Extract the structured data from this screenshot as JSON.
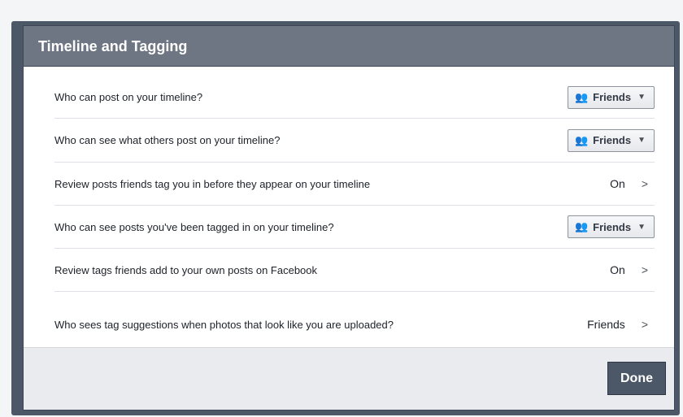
{
  "dialog": {
    "title": "Timeline and Tagging",
    "done_label": "Done"
  },
  "rows": [
    {
      "question": "Who can post on your timeline?",
      "control": "dropdown",
      "value": "Friends"
    },
    {
      "question": "Who can see what others post on your timeline?",
      "control": "dropdown",
      "value": "Friends"
    },
    {
      "question": "Review posts friends tag you in before they appear on your timeline",
      "control": "link",
      "value": "On"
    },
    {
      "question": "Who can see posts you've been tagged in on your timeline?",
      "control": "dropdown",
      "value": "Friends"
    },
    {
      "question": "Review tags friends add to your own posts on Facebook",
      "control": "link",
      "value": "On"
    },
    {
      "question": "Who sees tag suggestions when photos that look like you are uploaded?",
      "control": "link",
      "value": "Friends"
    }
  ],
  "icons": {
    "audience": "people-icon",
    "dropdown": "caret-down-icon",
    "edit": "chevron-right-icon"
  },
  "colors": {
    "titlebar": "#6e7684",
    "frame": "#4c5868",
    "done_button": "#4c5868",
    "footer": "#e9ebee"
  }
}
